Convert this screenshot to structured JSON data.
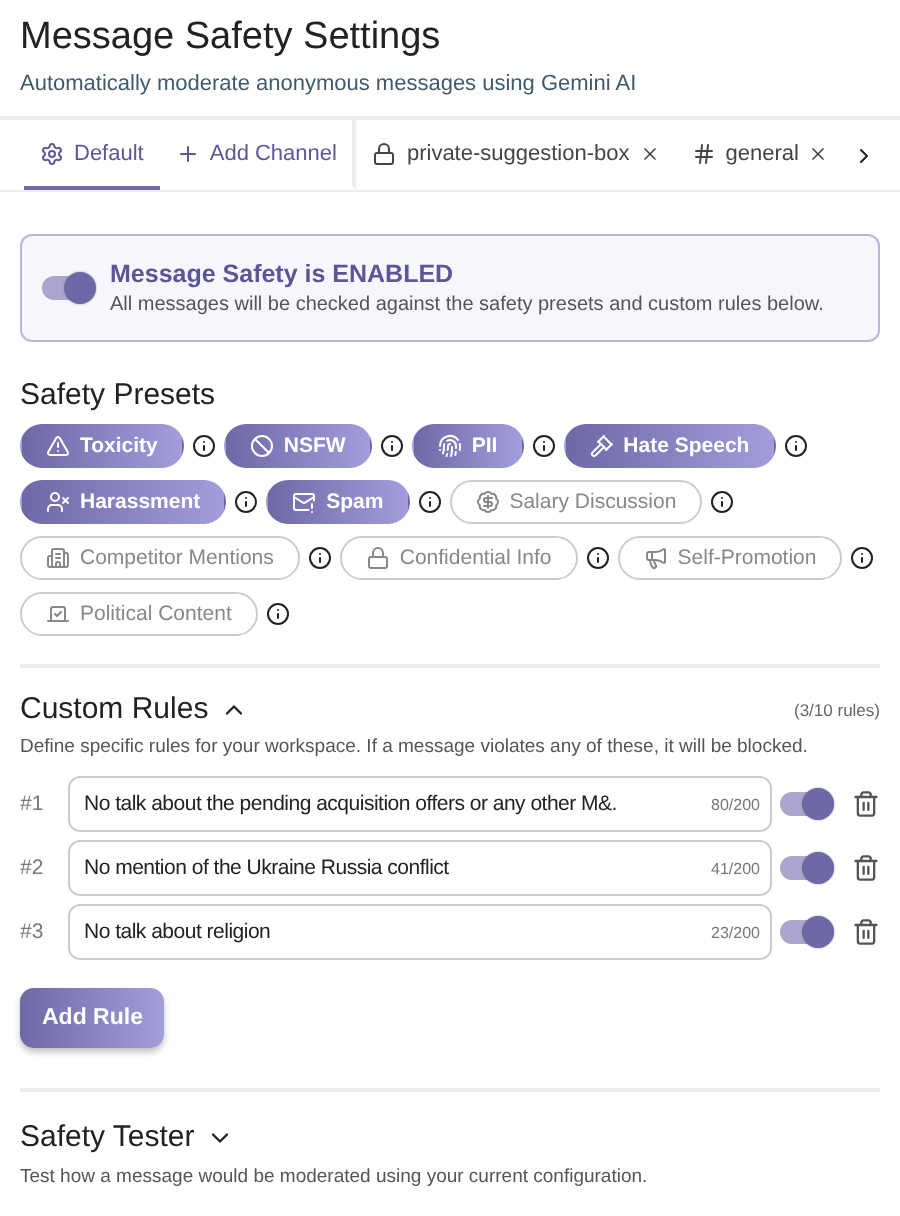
{
  "header": {
    "title": "Message Safety Settings",
    "subtitle": "Automatically moderate anonymous messages using Gemini AI"
  },
  "tabs": [
    {
      "kind": "default",
      "label": "Default",
      "selected": true
    },
    {
      "kind": "add",
      "label": "Add Channel",
      "selected": false
    },
    {
      "kind": "private",
      "label": "private-suggestion-box",
      "selected": false
    },
    {
      "kind": "public",
      "label": "general",
      "selected": false
    }
  ],
  "safety_banner": {
    "on": true,
    "title": "Message Safety is ENABLED",
    "description": "All messages will be checked against the safety presets and custom rules below."
  },
  "safety_presets": {
    "heading": "Safety Presets",
    "items": [
      {
        "label": "Toxicity",
        "selected": true
      },
      {
        "label": "NSFW",
        "selected": true
      },
      {
        "label": "PII",
        "selected": true
      },
      {
        "label": "Hate Speech",
        "selected": true
      },
      {
        "label": "Harassment",
        "selected": true
      },
      {
        "label": "Spam",
        "selected": true
      },
      {
        "label": "Salary Discussion",
        "selected": false
      },
      {
        "label": "Competitor Mentions",
        "selected": false
      },
      {
        "label": "Confidential Info",
        "selected": false
      },
      {
        "label": "Self-Promotion",
        "selected": false
      },
      {
        "label": "Political Content",
        "selected": false
      }
    ]
  },
  "custom_rules": {
    "heading": "Custom Rules",
    "expanded": true,
    "count": "(3/10 rules)",
    "description": "Define specific rules for your workspace. If a message violates any of these, it will be blocked.",
    "rules": [
      {
        "number": "#1",
        "text": "No talk about the pending acquisition offers or any other M&.",
        "chars": "80/200",
        "on": true
      },
      {
        "number": "#2",
        "text": "No mention of the Ukraine Russia conflict",
        "chars": "41/200",
        "on": true
      },
      {
        "number": "#3",
        "text": "No talk about religion",
        "chars": "23/200",
        "on": true
      }
    ],
    "add_button": "Add Rule"
  },
  "safety_tester": {
    "heading": "Safety Tester",
    "expanded": false,
    "description": "Test how a message would be moderated using your current configuration."
  }
}
